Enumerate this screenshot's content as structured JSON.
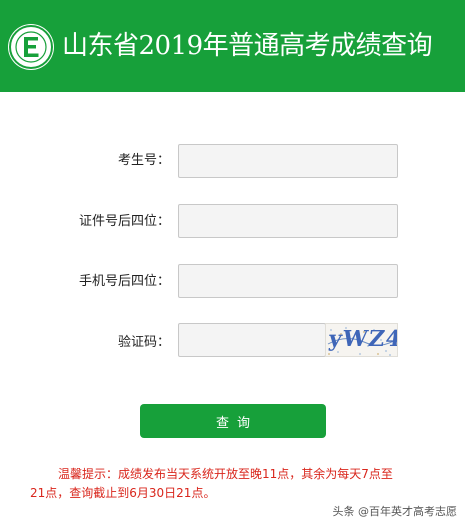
{
  "header": {
    "title": "山东省2019年普通高考成绩查询",
    "bg_color": "#17a03a",
    "logo_icon": "exam-board-seal-icon"
  },
  "form": {
    "fields": [
      {
        "label": "考生号：",
        "value": ""
      },
      {
        "label": "证件号后四位：",
        "value": ""
      },
      {
        "label": "手机号后四位：",
        "value": ""
      },
      {
        "label": "验证码：",
        "value": ""
      }
    ],
    "captcha_text": "yWZ4",
    "submit_label": "查询"
  },
  "notice": {
    "line1": "温馨提示：成绩发布当天系统开放至晚11点，其余为每天7点至",
    "line2": "21点，查询截止到6月30日21点。",
    "color": "#d9261c"
  },
  "watermark": {
    "text": "头条 @百年英才高考志愿"
  }
}
